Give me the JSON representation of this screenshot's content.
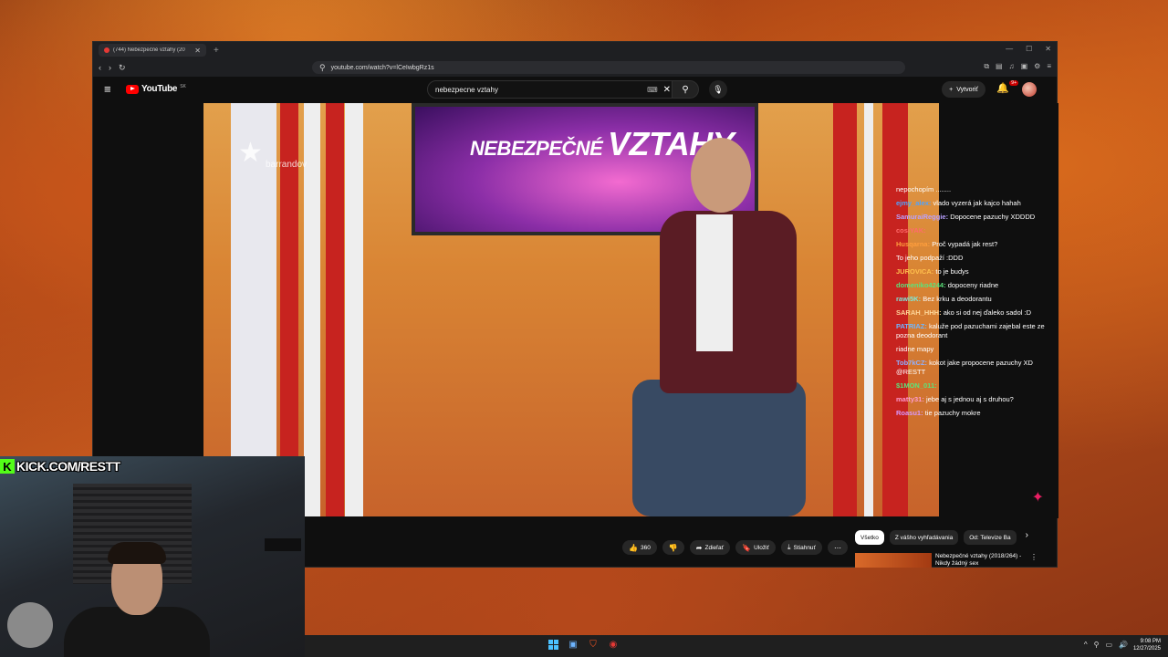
{
  "browser": {
    "tab_title": "(744) Nebezpečné vztahy (20",
    "url": "youtube.com/watch?v=lCeIwbgRz1s"
  },
  "youtube": {
    "logo_text": "YouTube",
    "country_code": "SK",
    "search_value": "nebezpecne vztahy",
    "create_label": "Vytvoriť",
    "notification_count": "9+"
  },
  "video": {
    "show_title": "NEBEZPEČNÉ",
    "show_title_big": "VZTAHY",
    "channel_logo": "barrandov"
  },
  "chat": [
    {
      "user": "",
      "text": "nepochopím ........"
    },
    {
      "user": "ejmy_alex:",
      "text": "vlado vyzerá jak kajco hahah",
      "color": "#4ea3ff"
    },
    {
      "user": "SamuraiReggie:",
      "text": "Dopocene pazuchy XDDDD",
      "color": "#b8a0ff"
    },
    {
      "user": "cosiYAK:",
      "text": "",
      "color": "#ff6b6b"
    },
    {
      "user": "Husqarna:",
      "text": "Proč vypadá jak rest?",
      "color": "#ff9e3d"
    },
    {
      "user": "",
      "text": "To jeho podpaží :DDD",
      "color": "#ff4444"
    },
    {
      "user": "JUROVICA:",
      "text": "to je budys",
      "color": "#ffc04d"
    },
    {
      "user": "domeniko4244:",
      "text": "dopoceny riadne",
      "color": "#5be37a"
    },
    {
      "user": "rawi5K:",
      "text": "Bez krku a deodorantu",
      "color": "#7ee8d9"
    },
    {
      "user": "SARAH_HHH:",
      "text": "ako si od nej ďaleko sadol :D",
      "color": "#ffd79a"
    },
    {
      "user": "PATRIAZ:",
      "text": "kaluže pod pazuchami zajebal este ze pozna deodorant",
      "color": "#6fb6ff"
    },
    {
      "user": "",
      "text": "riadne mapy",
      "color": "#c94dff"
    },
    {
      "user": "Tob7kCZ:",
      "text": "kokot jake propocene pazuchy XD @RESTT",
      "color": "#8fb0ff"
    },
    {
      "user": "$1MON_011:",
      "text": "",
      "color": "#5be37a"
    },
    {
      "user": "matty31:",
      "text": "jebe aj s jednou aj s druhou?",
      "color": "#ff9bd0"
    },
    {
      "user": "Roasu1:",
      "text": "tie pazuchy mokre",
      "color": "#d89aff"
    }
  ],
  "actions": {
    "likes": "360",
    "share": "Zdieľať",
    "save": "Uložiť",
    "download": "Stiahnuť"
  },
  "chips": [
    "Všetko",
    "Z vášho vyhľadávania",
    "Od: Televize Ba"
  ],
  "recommendation": {
    "title": "Nebezpečné vztahy (2018/264) - Nikdy žádný sex"
  },
  "kick_banner": "KICK.COM/RESTT",
  "clock": {
    "time": "9:08 PM",
    "date": "12/27/2025"
  },
  "colors": {
    "yt_red": "#ff0000",
    "kick_green": "#53fc18",
    "accent_pink": "#e91e63"
  }
}
